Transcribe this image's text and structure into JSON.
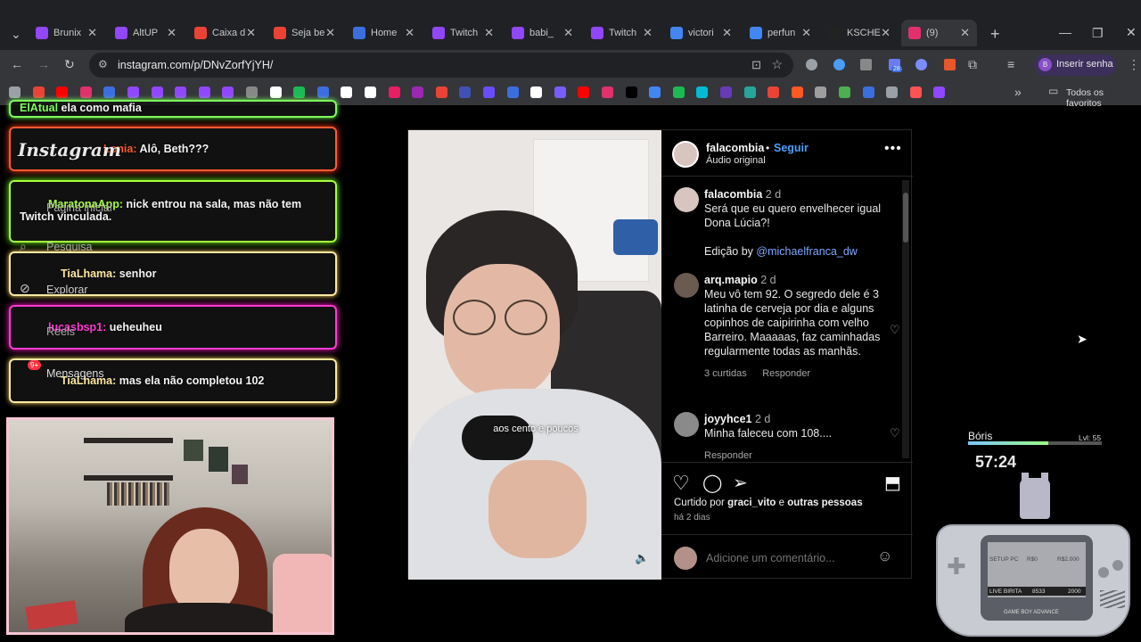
{
  "browser": {
    "tabs": [
      {
        "label": "Brunix",
        "color": "#9146ff"
      },
      {
        "label": "AltUP",
        "color": "#9146ff"
      },
      {
        "label": "Caixa d",
        "color": "#ea4335"
      },
      {
        "label": "Seja be",
        "color": "#ea4335"
      },
      {
        "label": "Home",
        "color": "#3b6fe0"
      },
      {
        "label": "Twitch",
        "color": "#9146ff"
      },
      {
        "label": "babi_",
        "color": "#9146ff"
      },
      {
        "label": "Twitch",
        "color": "#9146ff"
      },
      {
        "label": "victori",
        "color": "#4285f4"
      },
      {
        "label": "perfun",
        "color": "#4285f4"
      },
      {
        "label": "KSCHE",
        "color": "#222222"
      },
      {
        "label": "(9)",
        "color": "#e1306c"
      }
    ],
    "url": "instagram.com/p/DNvZorfYjYH/",
    "profile_label": "Inserir senha",
    "profile_initial": "B",
    "bookmarks_all": "Todos os favoritos",
    "extension_badge": "28"
  },
  "overlay": {
    "chat": [
      {
        "user": "ElAtual",
        "text": "ela como mafia",
        "color": "#7cff5b"
      },
      {
        "user": "Lonia:",
        "text": "Alô, Beth???",
        "color": "#ff5b2d"
      },
      {
        "user": "MaratonaApp:",
        "text": "nick entrou na sala, mas não tem Twitch vinculada.",
        "color": "#a4ff3b"
      },
      {
        "user": "TiaLhama:",
        "text": "senhor",
        "color": "#ffe9a0"
      },
      {
        "user": "lucasbsp1:",
        "text": "ueheuheu",
        "color": "#ff3bd2"
      },
      {
        "user": "TiaLhama:",
        "text": "mas ela não completou 102",
        "color": "#ffe9a0"
      }
    ],
    "ig_logo": "Instagram",
    "ig_nav": [
      "Pagina inicial",
      "Pesquisa",
      "Explorar",
      "Reels",
      "Mensagens"
    ],
    "messages_badge": "9+"
  },
  "post": {
    "username": "falacombia",
    "follow": "Seguir",
    "audio": "Áudio original",
    "caption_user": "falacombia",
    "caption_time": "2 d",
    "caption_text": "Será que eu quero envelhecer igual Dona Lúcia?!",
    "caption_credit": "Edição by",
    "caption_mention": "@michaelfranca_dw",
    "comments": [
      {
        "user": "arq.mapio",
        "time": "2 d",
        "text": "Meu vô tem 92. O segredo dele é 3 latinha de cerveja por dia e alguns copinhos de caipirinha com velho Barreiro. Maaaaas, faz caminhadas regularmente todas as manhãs.",
        "likes": "3 curtidas",
        "reply": "Responder"
      },
      {
        "user": "joyyhce1",
        "time": "2 d",
        "text": "Minha faleceu com 108....",
        "reply": "Responder"
      }
    ],
    "liked_by_prefix": "Curtido por",
    "liked_by_user": "graci_vito",
    "liked_by_and": "e",
    "liked_by_others": "outras pessoas",
    "date": "há 2 dias",
    "comment_placeholder": "Adicione um comentário...",
    "video_subtitle": "aos cento e poucos"
  },
  "widget": {
    "name": "Bóris",
    "level": "Lvl: 55",
    "timer": "57:24",
    "xp_fraction": 0.6,
    "gba_lines": [
      "SETUP PC",
      "R$0",
      "R$2.000",
      "LIVE BIRITA",
      "8533",
      "2000"
    ],
    "gba_brand": "GAME BOY ADVANCE"
  }
}
